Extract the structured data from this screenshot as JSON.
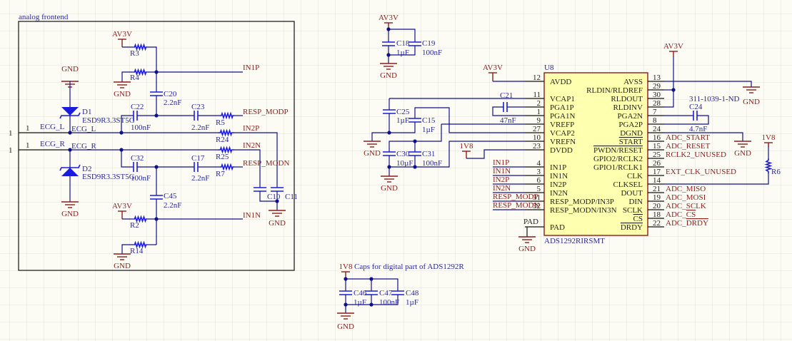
{
  "sheet": {
    "title": "analog frontend",
    "note": "Caps for digital part of ADS1292R"
  },
  "colors": {
    "wire": "#10108c",
    "component": "#1a1ae0",
    "net_label": "#8b1c1c",
    "ic_body": "#ffffb0",
    "ic_border": "#8b1c1c",
    "background": "#fdfcf4"
  },
  "ports": {
    "left_num": "1",
    "right_num": "1",
    "left_pin": "1",
    "right_pin": "1",
    "ecg_l": "ECG_L",
    "ecg_r": "ECG_R"
  },
  "power": {
    "av3v": "AV3V",
    "gnd": "GND",
    "v1v8": "1V8"
  },
  "nets": {
    "ecg_l": "ECG_L",
    "ecg_r": "ECG_R",
    "in1p": "IN1P",
    "in1n": "IN1N",
    "in2p": "IN2P",
    "in2n": "IN2N",
    "resp_modp": "RESP_MODP",
    "resp_modn": "RESP_MODN",
    "adc_start": "ADC_START",
    "adc_reset": "ADC_RESET",
    "rclk2": "RCLK2_UNUSED",
    "ext_clk": "EXT_CLK_UNUSED",
    "adc_miso": "ADC_MISO",
    "adc_mosi": "ADC_MOSI",
    "adc_sclk": "ADC_SCLK",
    "adc_cs_prefix": "ADC_",
    "adc_cs": "CS",
    "adc_drdy_prefix": "ADC_",
    "adc_drdy": "DRDY"
  },
  "components": {
    "D1": {
      "ref": "D1",
      "value": "ESD9R3.3ST5G"
    },
    "D2": {
      "ref": "D2",
      "value": "ESD9R3.3ST5G"
    },
    "R3": {
      "ref": "R3"
    },
    "R4": {
      "ref": "R4"
    },
    "R2": {
      "ref": "R2"
    },
    "R14": {
      "ref": "R14"
    },
    "R5": {
      "ref": "R5"
    },
    "R24": {
      "ref": "R24"
    },
    "R25": {
      "ref": "R25"
    },
    "R7": {
      "ref": "R7"
    },
    "R6": {
      "ref": "R6"
    },
    "C20": {
      "ref": "C20",
      "value": "2.2nF"
    },
    "C22": {
      "ref": "C22",
      "value": "100nF"
    },
    "C23": {
      "ref": "C23",
      "value": "2.2nF"
    },
    "C32": {
      "ref": "C32",
      "value": "100nF"
    },
    "C17": {
      "ref": "C17",
      "value": "2.2nF"
    },
    "C45": {
      "ref": "C45",
      "value": "2.2nF"
    },
    "C10": {
      "ref": "C10"
    },
    "C11": {
      "ref": "C11"
    },
    "C18": {
      "ref": "C18",
      "value": "1µF"
    },
    "C19": {
      "ref": "C19",
      "value": "100nF"
    },
    "C25": {
      "ref": "C25",
      "value": "1µF"
    },
    "C15": {
      "ref": "C15",
      "value": "1µF"
    },
    "C30": {
      "ref": "C30",
      "value": "10µF"
    },
    "C31": {
      "ref": "C31",
      "value": "100nF"
    },
    "C21": {
      "ref": "C21",
      "value": "47nF"
    },
    "C24": {
      "ref": "C24",
      "value": "4.7nF",
      "part": "311-1039-1-ND"
    },
    "C46": {
      "ref": "C46",
      "value": "1µF"
    },
    "C47": {
      "ref": "C47",
      "value": "100nF"
    },
    "C48": {
      "ref": "C48",
      "value": "1µF"
    }
  },
  "u8": {
    "ref": "U8",
    "part": "ADS1292RIRSMT",
    "left_pins": [
      {
        "num": "12",
        "name": "AVDD"
      },
      {
        "num": "11",
        "name": "VCAP1"
      },
      {
        "num": "2",
        "name": "PGA1P"
      },
      {
        "num": "1",
        "name": "PGA1N"
      },
      {
        "num": "9",
        "name": "VREFP"
      },
      {
        "num": "27",
        "name": "VCAP2"
      },
      {
        "num": "10",
        "name": "VREFN"
      },
      {
        "num": "23",
        "name": "DVDD"
      },
      {
        "num": "4",
        "name": "IN1P"
      },
      {
        "num": "3",
        "name": "IN1N"
      },
      {
        "num": "6",
        "name": "IN2P"
      },
      {
        "num": "5",
        "name": "IN2N"
      },
      {
        "num": "31",
        "name": "RESP_MODP/IN3P"
      },
      {
        "num": "32",
        "name": "RESP_MODN/IN3N"
      },
      {
        "num": "PAD",
        "name": "PAD"
      }
    ],
    "right_pins": [
      {
        "num": "13",
        "name": "AVSS"
      },
      {
        "num": "29",
        "name": "RLDIN/RLDREF"
      },
      {
        "num": "30",
        "name": "RLDOUT"
      },
      {
        "num": "28",
        "name": "RLDINV"
      },
      {
        "num": "7",
        "name": "PGA2N"
      },
      {
        "num": "8",
        "name": "PGA2P"
      },
      {
        "num": "24",
        "name": "DGND"
      },
      {
        "num": "16",
        "name": "START",
        "overline": true
      },
      {
        "num": "15",
        "name": "PWDN/RESET",
        "overline": true
      },
      {
        "num": "25",
        "name": "GPIO2/RCLK2"
      },
      {
        "num": "26",
        "name": "GPIO1/RCLK1"
      },
      {
        "num": "17",
        "name": "CLK"
      },
      {
        "num": "14",
        "name": "CLKSEL"
      },
      {
        "num": "21",
        "name": "DOUT"
      },
      {
        "num": "19",
        "name": "DIN"
      },
      {
        "num": "20",
        "name": "SCLK"
      },
      {
        "num": "18",
        "name": "CS",
        "overline": true
      },
      {
        "num": "22",
        "name": "DRDY",
        "overline": true
      }
    ]
  }
}
